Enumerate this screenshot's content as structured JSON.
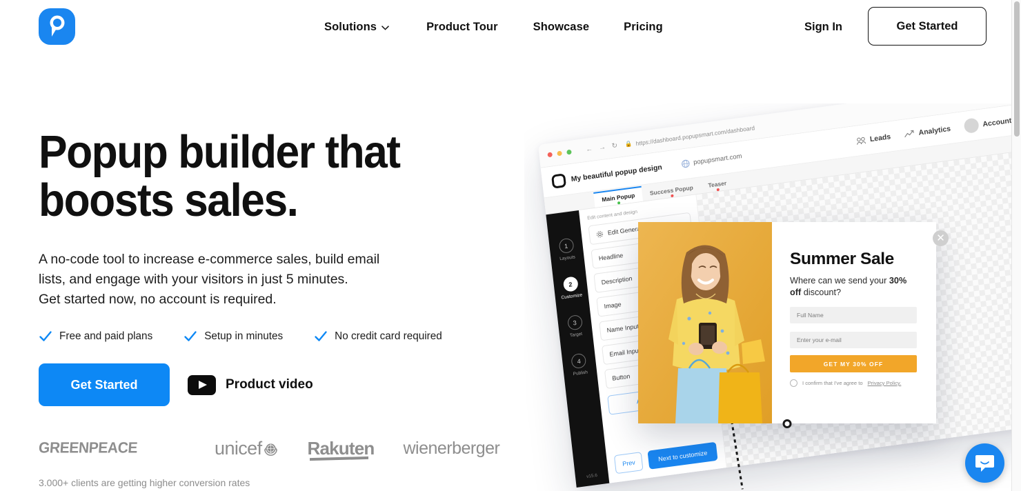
{
  "brand": {
    "logo_icon": "popupsmart-logo-icon",
    "accent_blue": "#0d88f5",
    "accent_orange": "#f2a629"
  },
  "header": {
    "nav": [
      {
        "label": "Solutions",
        "has_dropdown": true,
        "icon": "chevron-down-icon"
      },
      {
        "label": "Product Tour",
        "has_dropdown": false
      },
      {
        "label": "Showcase",
        "has_dropdown": false
      },
      {
        "label": "Pricing",
        "has_dropdown": false
      }
    ],
    "sign_in": "Sign In",
    "get_started": "Get Started"
  },
  "hero": {
    "headline_line1": "Popup builder that",
    "headline_line2": "boosts sales.",
    "subhead": "A no-code tool to increase e-commerce sales, build email\nlists, and engage with your visitors in just 5 minutes.\nGet started now, no account is required.",
    "features": [
      {
        "icon": "check-icon",
        "label": "Free and paid plans"
      },
      {
        "icon": "check-icon",
        "label": "Setup in minutes"
      },
      {
        "icon": "check-icon",
        "label": "No credit card required"
      }
    ],
    "cta_primary": "Get Started",
    "video_icon": "youtube-play-icon",
    "video_label": "Product video"
  },
  "clients": {
    "logos": [
      "GREENPEACE",
      "unicef",
      "Rakuten",
      "wienerberger"
    ],
    "unicef_emblem_icon": "unicef-globe-icon",
    "note": "3.000+ clients are getting higher conversion rates"
  },
  "mockup": {
    "browser": {
      "url": "https://dashboard.popupsmart.com/dashboard",
      "back_icon": "arrow-left-icon",
      "forward_icon": "arrow-right-icon",
      "reload_icon": "reload-icon",
      "lock_icon": "lock-icon"
    },
    "app": {
      "project_title": "My beautiful popup design",
      "domain": "popupsmart.com",
      "domain_icon": "globe-icon",
      "top_links": [
        {
          "label": "Leads",
          "icon": "leads-icon"
        },
        {
          "label": "Analytics",
          "icon": "analytics-icon"
        },
        {
          "label": "Account",
          "icon": "avatar-icon"
        }
      ],
      "tabs": [
        {
          "label": "Main Popup",
          "state": "active",
          "dot": "green"
        },
        {
          "label": "Success Popup",
          "state": "inactive",
          "dot": "red"
        },
        {
          "label": "Teaser",
          "state": "inactive",
          "dot": "red"
        }
      ],
      "rail_steps": [
        {
          "num": "1",
          "label": "Layouts",
          "active": false
        },
        {
          "num": "2",
          "label": "Customize",
          "active": true
        },
        {
          "num": "3",
          "label": "Target",
          "active": false
        },
        {
          "num": "4",
          "label": "Publish",
          "active": false
        }
      ],
      "version": "v15.6",
      "panel_hint": "Edit content and design",
      "panel_items": [
        {
          "label": "Edit General",
          "icon": "gear-icon"
        },
        {
          "label": "Headline",
          "icon": ""
        },
        {
          "label": "Description",
          "icon": ""
        },
        {
          "label": "Image",
          "icon": ""
        },
        {
          "label": "Name Input",
          "icon": ""
        },
        {
          "label": "Email Input",
          "icon": ""
        },
        {
          "label": "Button",
          "icon": ""
        }
      ],
      "panel_add": "Add a new block",
      "btn_prev": "Prev",
      "btn_next": "Next to customize"
    },
    "popup": {
      "close_icon": "close-icon",
      "title": "Summer Sale",
      "sub_before": "Where can we send your ",
      "sub_bold": "30% off",
      "sub_after": " discount?",
      "input_name_placeholder": "Full Name",
      "input_email_placeholder": "Enter your e-mail",
      "cta": "GET MY 30% OFF",
      "consent_text": "I confirm that I've agree to ",
      "consent_link": "Privacy Policy.",
      "image_alt": "woman-with-phone-and-shopping-bags"
    }
  },
  "chat": {
    "icon": "chat-bubble-icon"
  }
}
